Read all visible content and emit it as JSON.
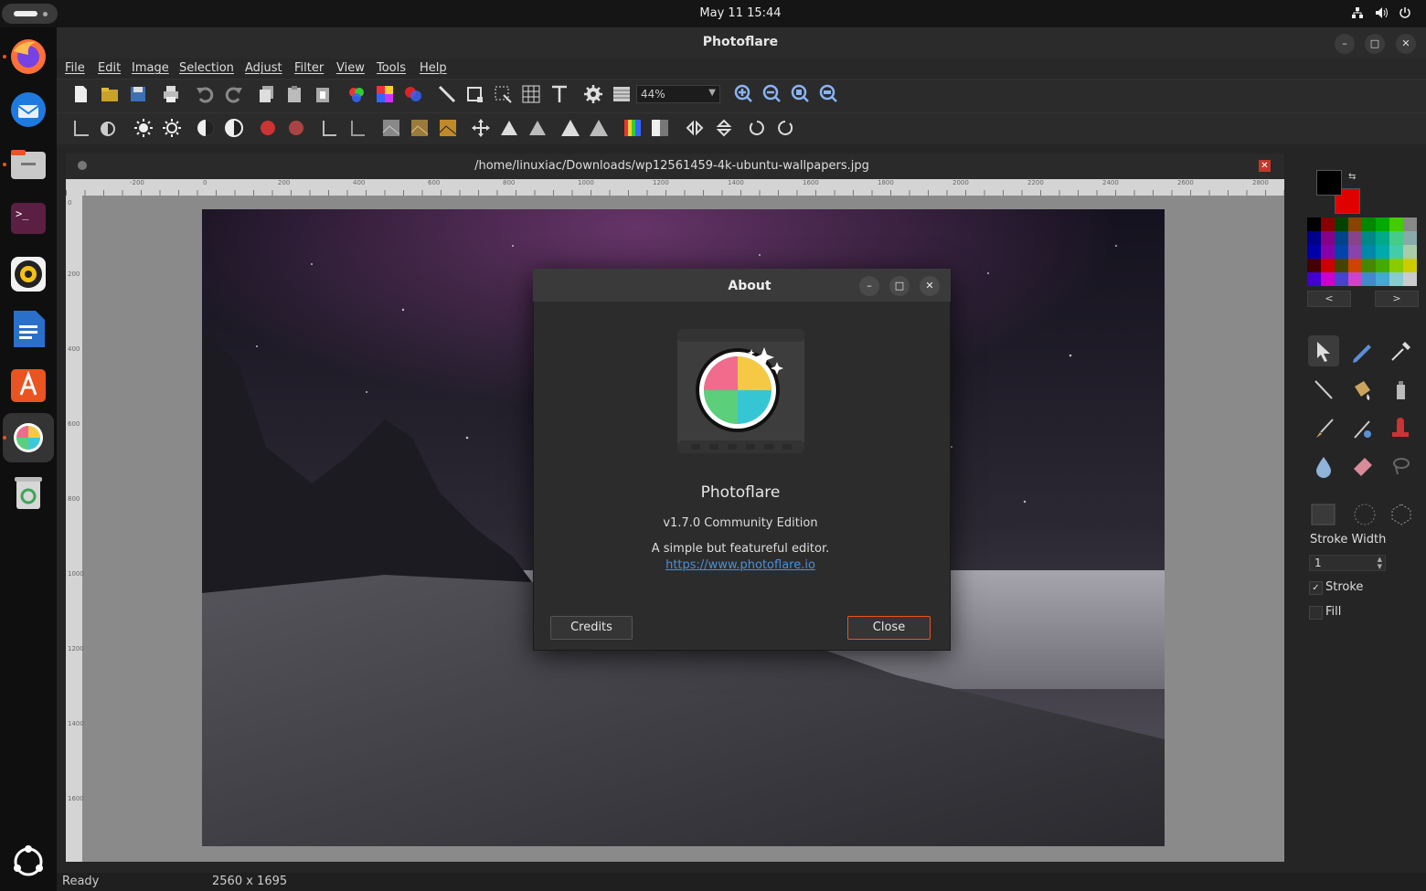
{
  "topbar": {
    "clock": "May 11  15:44",
    "tray_icons": [
      "network-icon",
      "volume-icon",
      "power-icon"
    ]
  },
  "dock": {
    "apps": [
      "Firefox",
      "Thunderbird",
      "Files",
      "Terminal",
      "Rhythmbox",
      "LibreOffice Writer",
      "App Center",
      "Photoflare",
      "Trash"
    ]
  },
  "window": {
    "title": "Photoflare",
    "menu": [
      "File",
      "Edit",
      "Image",
      "Selection",
      "Adjust",
      "Filter",
      "View",
      "Tools",
      "Help"
    ],
    "zoom_value": "44%"
  },
  "document": {
    "path": "/home/linuxiac/Downloads/wp12561459-4k-ubuntu-wallpapers.jpg",
    "ruler_h": [
      "-200",
      "0",
      "200",
      "400",
      "600",
      "800",
      "1000",
      "1200",
      "1400",
      "1600",
      "1800",
      "2000",
      "2200",
      "2400",
      "2600",
      "2800"
    ],
    "ruler_v": [
      "0",
      "200",
      "400",
      "600",
      "800",
      "1000",
      "1200",
      "1400",
      "1600"
    ]
  },
  "panel": {
    "palette_prev": "<",
    "palette_next": ">",
    "stroke_width_label": "Stroke Width",
    "stroke_width_value": "1",
    "stroke_label": "Stroke",
    "fill_label": "Fill",
    "stroke_checked": true,
    "fill_checked": false,
    "primary_color": "#000000",
    "secondary_color": "#e00000"
  },
  "status": {
    "text": "Ready",
    "dimensions": "2560 x 1695"
  },
  "about": {
    "title": "About",
    "app_name": "Photoflare",
    "version": "v1.7.0 Community Edition",
    "description": "A simple but featureful editor.",
    "url": "https://www.photoflare.io",
    "credits_label": "Credits",
    "close_label": "Close"
  }
}
